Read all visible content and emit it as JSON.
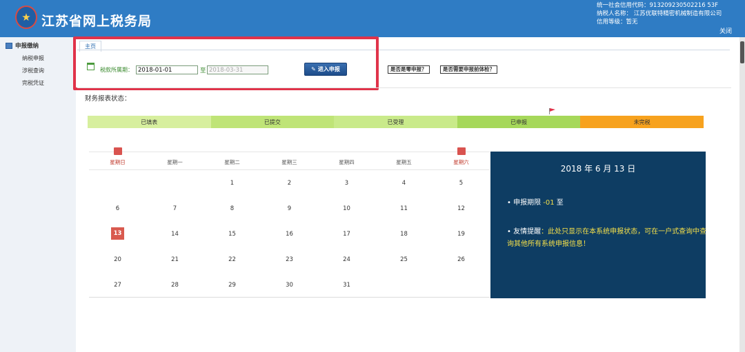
{
  "header": {
    "site_title": "江苏省网上税务局",
    "credit_code_line": "统一社会信用代码：913209230502216 53F",
    "taxpayer_line": "纳税人名称： 江苏优联特精密机械制造有限公司",
    "credit_level_line": "信用等级：暂无",
    "close_label": "关闭"
  },
  "sidebar": {
    "title": "申报缴纳",
    "items": [
      {
        "label": "纳税申报"
      },
      {
        "label": "涉税查询"
      },
      {
        "label": "完税凭证"
      }
    ]
  },
  "tab": {
    "label": "主页"
  },
  "period": {
    "label": "税款所属期：",
    "start_value": "2018-01-01",
    "to_label": "至",
    "end_value": "2018-03-31",
    "enter_button": "进入申报",
    "question_buttons": [
      "是否是零申报？",
      "是否需要申报前体检？"
    ]
  },
  "status": {
    "title": "财务报表状态：",
    "segments": [
      {
        "label": "已填表",
        "color": "#d7ef9e"
      },
      {
        "label": "已提交",
        "color": "#bfe477"
      },
      {
        "label": "已受理",
        "color": "#c9ea8a"
      },
      {
        "label": "已申报",
        "color": "#a6d85a"
      },
      {
        "label": "未完税",
        "color": "#f7a21e"
      }
    ],
    "flag_color": "#e0334a"
  },
  "calendar": {
    "weekdays": [
      "星期日",
      "星期一",
      "星期二",
      "星期三",
      "星期四",
      "星期五",
      "星期六"
    ],
    "weeks": [
      [
        "",
        "",
        "1",
        "2",
        "3",
        "4",
        "5"
      ],
      [
        "6",
        "7",
        "8",
        "9",
        "10",
        "11",
        "12"
      ],
      [
        "13",
        "14",
        "15",
        "16",
        "17",
        "18",
        "19"
      ],
      [
        "20",
        "21",
        "22",
        "23",
        "24",
        "25",
        "26"
      ],
      [
        "27",
        "28",
        "29",
        "30",
        "31",
        "",
        ""
      ]
    ],
    "today": "13"
  },
  "info": {
    "date_title": "2018 年 6 月 13 日",
    "deadline_label": "• 申报期限",
    "deadline_value": "-01",
    "deadline_suffix": "至",
    "tip_label": "• 友情提醒",
    "tip_text": "：此处只显示在本系统申报状态，可在一户式查询中查询其他所有系统申报信息！"
  }
}
